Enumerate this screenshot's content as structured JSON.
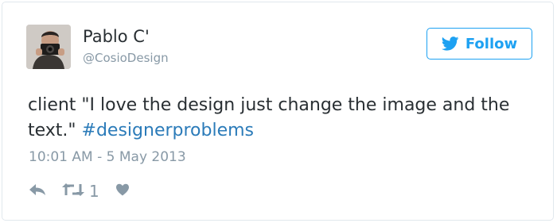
{
  "tweet": {
    "author": {
      "name": "Pablo C'",
      "handle": "@CosioDesign"
    },
    "follow_label": "Follow",
    "text_main": "client \"I love the design just change the image and the text.\" ",
    "hashtag": "#designerproblems",
    "timestamp": "10:01 AM - 5 May 2013",
    "retweet_count": "1",
    "icons": {
      "follow": "twitter-bird-icon",
      "reply": "reply-arrow-icon",
      "retweet": "retweet-icon",
      "like": "heart-icon"
    }
  },
  "colors": {
    "accent": "#1da1f2",
    "link": "#2b7bb9",
    "text": "#292f33",
    "muted": "#8899a6",
    "border": "#e1e8ed"
  }
}
